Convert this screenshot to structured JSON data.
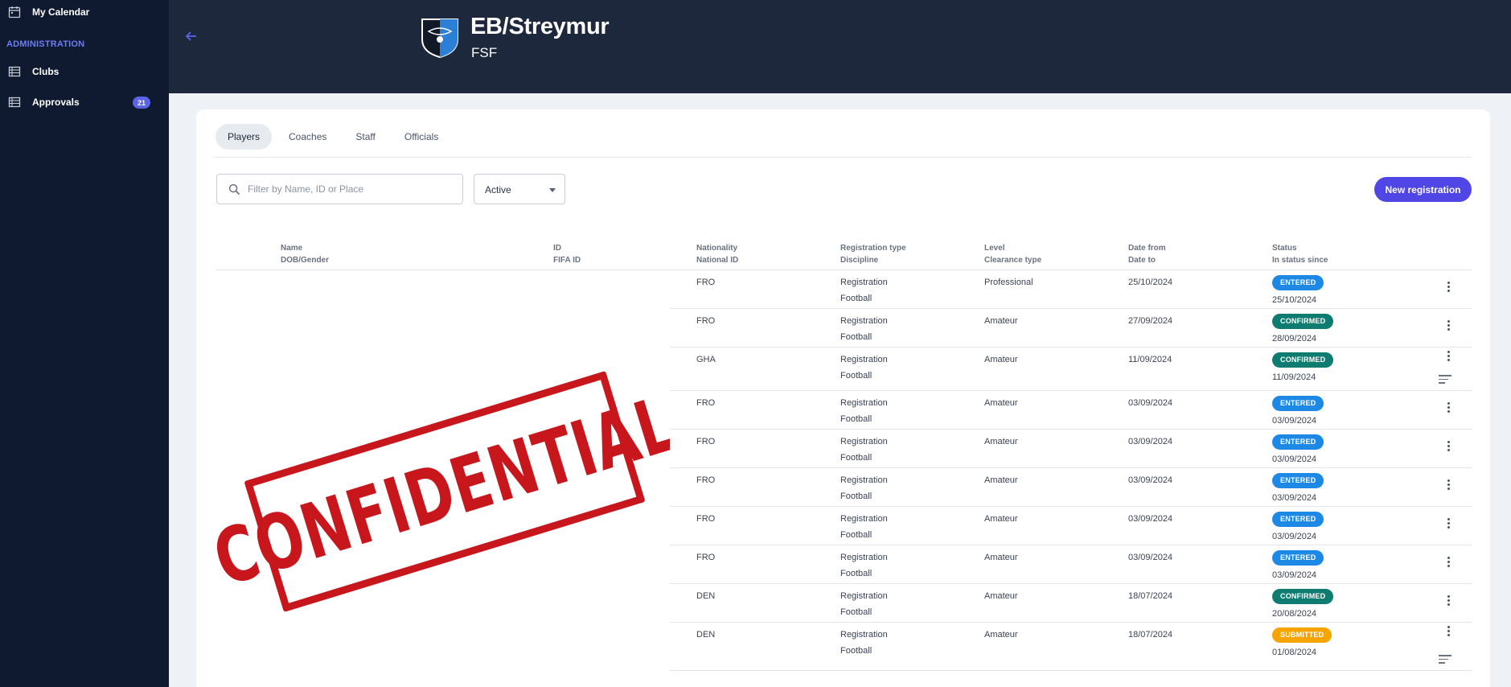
{
  "sidebar": {
    "items": [
      {
        "label": "My Calendar",
        "icon": "calendar-icon"
      },
      {
        "label": "Clubs",
        "icon": "table-icon"
      },
      {
        "label": "Approvals",
        "icon": "table-icon",
        "badge": "21"
      }
    ],
    "section_label": "ADMINISTRATION"
  },
  "header": {
    "title": "EB/Streymur",
    "subtitle": "FSF"
  },
  "tabs": [
    {
      "label": "Players",
      "active": true
    },
    {
      "label": "Coaches",
      "active": false
    },
    {
      "label": "Staff",
      "active": false
    },
    {
      "label": "Officials",
      "active": false
    }
  ],
  "filter": {
    "search_placeholder": "Filter by Name, ID or Place",
    "status_value": "Active"
  },
  "new_registration_label": "New registration",
  "table": {
    "headers": [
      [
        "Name",
        "DOB/Gender"
      ],
      [
        "ID",
        "FIFA ID"
      ],
      [
        "Nationality",
        "National ID"
      ],
      [
        "Registration type",
        "Discipline"
      ],
      [
        "Level",
        "Clearance type"
      ],
      [
        "Date from",
        "Date to"
      ],
      [
        "Status",
        "In status since"
      ]
    ],
    "rows": [
      {
        "nationality": "FRO",
        "reg_type": "Registration",
        "discipline": "Football",
        "level": "Professional",
        "date_from": "25/10/2024",
        "status": "ENTERED",
        "since": "25/10/2024",
        "notes": false
      },
      {
        "nationality": "FRO",
        "reg_type": "Registration",
        "discipline": "Football",
        "level": "Amateur",
        "date_from": "27/09/2024",
        "status": "CONFIRMED",
        "since": "28/09/2024",
        "notes": false
      },
      {
        "nationality": "GHA",
        "reg_type": "Registration",
        "discipline": "Football",
        "level": "Amateur",
        "date_from": "11/09/2024",
        "status": "CONFIRMED",
        "since": "11/09/2024",
        "notes": true
      },
      {
        "nationality": "FRO",
        "reg_type": "Registration",
        "discipline": "Football",
        "level": "Amateur",
        "date_from": "03/09/2024",
        "status": "ENTERED",
        "since": "03/09/2024",
        "notes": false
      },
      {
        "nationality": "FRO",
        "reg_type": "Registration",
        "discipline": "Football",
        "level": "Amateur",
        "date_from": "03/09/2024",
        "status": "ENTERED",
        "since": "03/09/2024",
        "notes": false
      },
      {
        "nationality": "FRO",
        "reg_type": "Registration",
        "discipline": "Football",
        "level": "Amateur",
        "date_from": "03/09/2024",
        "status": "ENTERED",
        "since": "03/09/2024",
        "notes": false
      },
      {
        "nationality": "FRO",
        "reg_type": "Registration",
        "discipline": "Football",
        "level": "Amateur",
        "date_from": "03/09/2024",
        "status": "ENTERED",
        "since": "03/09/2024",
        "notes": false
      },
      {
        "nationality": "FRO",
        "reg_type": "Registration",
        "discipline": "Football",
        "level": "Amateur",
        "date_from": "03/09/2024",
        "status": "ENTERED",
        "since": "03/09/2024",
        "notes": false
      },
      {
        "nationality": "DEN",
        "reg_type": "Registration",
        "discipline": "Football",
        "level": "Amateur",
        "date_from": "18/07/2024",
        "status": "CONFIRMED",
        "since": "20/08/2024",
        "notes": false
      },
      {
        "nationality": "DEN",
        "reg_type": "Registration",
        "discipline": "Football",
        "level": "Amateur",
        "date_from": "18/07/2024",
        "status": "SUBMITTED",
        "since": "01/08/2024",
        "notes": true
      }
    ]
  },
  "status_colors": {
    "ENTERED": "#1e88e5",
    "CONFIRMED": "#0e7c70",
    "SUBMITTED": "#f5a400"
  },
  "colors": {
    "sidebar_bg": "#0f1a30",
    "header_bg": "#1d283c",
    "accent": "#4f46e5",
    "stamp_red": "#c8161d"
  },
  "watermark_text": "CONFIDENTIAL"
}
